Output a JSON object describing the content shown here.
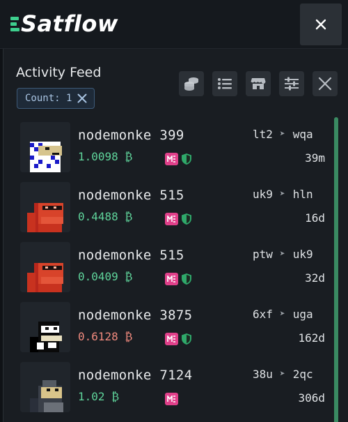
{
  "app": {
    "name": "Satflow"
  },
  "header": {
    "close_icon": "close-icon"
  },
  "feed": {
    "title": "Activity Feed",
    "count_label": "Count: 1",
    "toolbar": [
      {
        "name": "coins-icon-button",
        "icon": "coins-icon"
      },
      {
        "name": "list-view-button",
        "icon": "list-icon"
      },
      {
        "name": "marketplace-button",
        "icon": "store-icon"
      },
      {
        "name": "filters-button",
        "icon": "sliders-icon"
      },
      {
        "name": "clear-button",
        "icon": "close-icon"
      }
    ]
  },
  "colors": {
    "accent_green": "#3ecf8e",
    "price_up": "#5fd49b",
    "price_down": "#f08a7e",
    "magic_eden": "#e0408a",
    "shield": "#2fa86a",
    "scroll": "#3a8a62"
  },
  "items": [
    {
      "name": "nodemonke 399",
      "price": "1.0098 ₿",
      "trend": "up",
      "from": "lt2",
      "to": "wqa",
      "age": "39m",
      "verified": true,
      "avatar": "blue-white"
    },
    {
      "name": "nodemonke 515",
      "price": "0.4488 ₿",
      "trend": "up",
      "from": "uk9",
      "to": "hln",
      "age": "16d",
      "verified": true,
      "avatar": "red"
    },
    {
      "name": "nodemonke 515",
      "price": "0.0409 ₿",
      "trend": "up",
      "from": "ptw",
      "to": "uk9",
      "age": "32d",
      "verified": true,
      "avatar": "red"
    },
    {
      "name": "nodemonke 3875",
      "price": "0.6128 ₿",
      "trend": "down",
      "from": "6xf",
      "to": "uga",
      "age": "162d",
      "verified": true,
      "avatar": "black-white"
    },
    {
      "name": "nodemonke 7124",
      "price": "1.02 ₿",
      "trend": "up",
      "from": "38u",
      "to": "2qc",
      "age": "306d",
      "verified": false,
      "avatar": "dark-tan"
    }
  ]
}
